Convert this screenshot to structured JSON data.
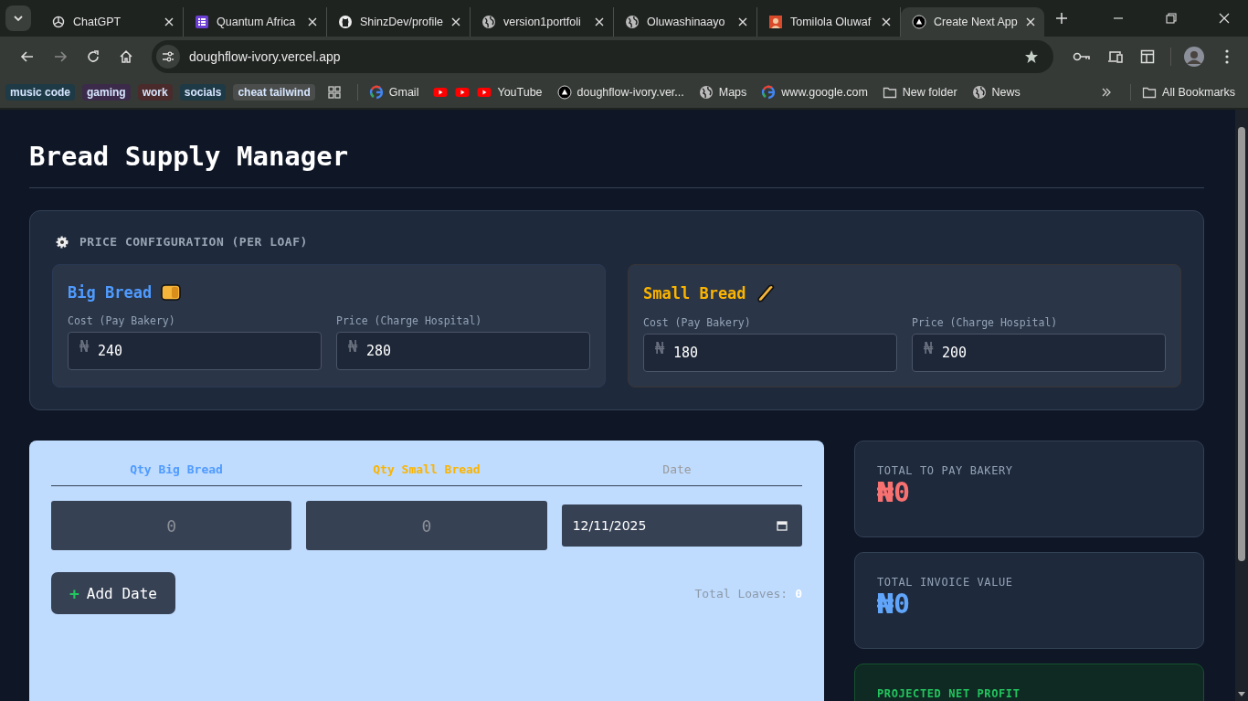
{
  "browser": {
    "tabs": [
      {
        "kind": "openai",
        "title": "ChatGPT",
        "selected": false
      },
      {
        "kind": "forms",
        "title": "Quantum Africa",
        "selected": false
      },
      {
        "kind": "github",
        "title": "ShinzDev/profile",
        "selected": false
      },
      {
        "kind": "globe",
        "title": "version1portfoli",
        "selected": false
      },
      {
        "kind": "globe",
        "title": "Oluwashinaayo",
        "selected": false
      },
      {
        "kind": "photo",
        "title": "Tomilola Oluwaf",
        "selected": false
      },
      {
        "kind": "next",
        "title": "Create Next App",
        "selected": true
      }
    ],
    "url": "doughflow-ivory.vercel.app",
    "bookmark_chips": [
      {
        "label": "music code",
        "color": "#1e3a46"
      },
      {
        "label": "gaming",
        "color": "#3b2a4a"
      },
      {
        "label": "work",
        "color": "#4a2a2a"
      },
      {
        "label": "socials",
        "color": "#1e3a46"
      },
      {
        "label": "cheat tailwind",
        "color": "#4a4d4b"
      }
    ],
    "bookmarks": [
      {
        "kind": "google",
        "label": "Gmail"
      },
      {
        "kind": "youtube"
      },
      {
        "kind": "youtube"
      },
      {
        "kind": "youtube",
        "label": "YouTube"
      },
      {
        "kind": "next",
        "label": "doughflow-ivory.ver..."
      },
      {
        "kind": "globe",
        "label": "Maps"
      },
      {
        "kind": "google",
        "label": "www.google.com"
      },
      {
        "kind": "folder",
        "label": "New folder"
      },
      {
        "kind": "globe",
        "label": "News"
      }
    ],
    "all_bookmarks": "All Bookmarks"
  },
  "page": {
    "title": "Bread Supply Manager",
    "price_config": {
      "heading": "PRICE CONFIGURATION (PER LOAF)",
      "products": [
        {
          "kind": "big",
          "name": "Big Bread",
          "fields": [
            {
              "label": "Cost (Pay Bakery)",
              "currency": "₦",
              "value": "240"
            },
            {
              "label": "Price (Charge Hospital)",
              "currency": "₦",
              "value": "280"
            }
          ]
        },
        {
          "kind": "small",
          "name": "Small Bread",
          "fields": [
            {
              "label": "Cost (Pay Bakery)",
              "currency": "₦",
              "value": "180"
            },
            {
              "label": "Price (Charge Hospital)",
              "currency": "₦",
              "value": "200"
            }
          ]
        }
      ]
    },
    "entry": {
      "columns": [
        {
          "kind": "big",
          "label": "Qty Big Bread"
        },
        {
          "kind": "small",
          "label": "Qty Small Bread"
        },
        {
          "kind": "date",
          "label": "Date"
        }
      ],
      "qty_big": {
        "placeholder": "0"
      },
      "qty_small": {
        "placeholder": "0"
      },
      "date": {
        "value": "12/11/2025"
      },
      "add_button": {
        "icon": "+",
        "label": "Add Date"
      },
      "total_label": "Total Loaves:",
      "total_value": "0"
    },
    "stats": [
      {
        "label": "TOTAL TO PAY BAKERY",
        "value": "₦0",
        "color": "#f87171",
        "highlight": false
      },
      {
        "label": "TOTAL INVOICE VALUE",
        "value": "₦0",
        "color": "#60a5fa",
        "highlight": false
      },
      {
        "label": "PROJECTED NET PROFIT",
        "color": "#22c55e",
        "highlight": true
      }
    ]
  }
}
